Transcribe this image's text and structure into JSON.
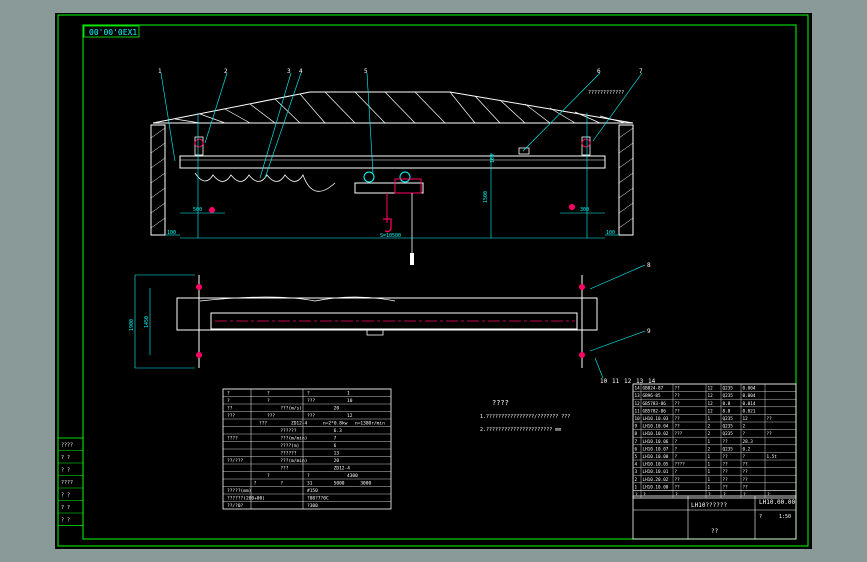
{
  "colors": {
    "background": "#8a9a98",
    "canvas": "#000000",
    "border": "#00ff00",
    "structure": "#ffffff",
    "dimension": "#00ffff",
    "accent": "#ff0066",
    "title_text": "#ffffff"
  },
  "drawing": {
    "sheet_tag": "00'00'0EX1",
    "balloons": [
      "1",
      "2",
      "3",
      "4",
      "5",
      "6",
      "7",
      "8",
      "9",
      "10",
      "11",
      "12",
      "13",
      "14"
    ],
    "top_view_callout": "????????????",
    "dims_side": [
      "500",
      "1500",
      "100",
      "100",
      "300",
      "160"
    ],
    "dims_plan": [
      "1900",
      "1450",
      "1500"
    ],
    "span_label": "S=10500",
    "spec_table_rows": [
      [
        "?",
        "?",
        "?",
        "1"
      ],
      [
        "?",
        "?",
        "???",
        "10"
      ],
      [
        "??",
        "???(m/s)",
        "20"
      ],
      [
        "???",
        "???",
        "???",
        "12"
      ],
      [
        "",
        "???",
        "ZD12-4",
        "n=2*0.8kw",
        "n=1380r/min"
      ],
      [
        "",
        "??????",
        "6.3"
      ],
      [
        "????",
        "???(m/min)",
        "7"
      ],
      [
        "",
        "????(m)",
        "6"
      ],
      [
        "",
        "??????",
        "13"
      ],
      [
        "??/???",
        "???(m/min)",
        "20"
      ],
      [
        "",
        "???",
        "ZD12-4"
      ],
      [
        "",
        "?",
        "?",
        "4300"
      ],
      [
        "",
        "?",
        "?",
        "31",
        "5000",
        "3000"
      ],
      [
        "?????(mm)",
        "#150"
      ],
      [
        "??????(200+00)",
        "?08?7?0C"
      ],
      [
        "??/?0?",
        "?300"
      ]
    ],
    "notes_title": "????",
    "notes_lines": [
      "1.????????????????/??????? ???",
      "2.?????????????????????? mm"
    ],
    "bom_rows": [
      [
        "14",
        "GB824-87",
        "??",
        "12",
        "Q235",
        "0.004"
      ],
      [
        "13",
        "GB96-85",
        "??",
        "12",
        "Q235",
        "0.004"
      ],
      [
        "12",
        "GB5783-86",
        "??",
        "12",
        "8.8",
        "0.014"
      ],
      [
        "11",
        "GB5782-86",
        "??",
        "12",
        "8.8",
        "0.021"
      ],
      [
        "10",
        "LH10.10.03",
        "??",
        "1",
        "Q235",
        "12",
        "??"
      ],
      [
        "9",
        "LH10.10.04",
        "??",
        "2",
        "Q235",
        "2"
      ],
      [
        "8",
        "LH10.10.02",
        "???",
        "2",
        "Q235",
        "?",
        "??"
      ],
      [
        "7",
        "LH10.10.06",
        "?",
        "1",
        "??",
        "28.3"
      ],
      [
        "6",
        "LH10.10.07",
        "?",
        "2",
        "Q235",
        "0.2"
      ],
      [
        "5",
        "LH10.10.08",
        "?",
        "1",
        "??",
        "?",
        "1.5t"
      ],
      [
        "4",
        "LH10.10.05",
        "????",
        "1",
        "??",
        "??"
      ],
      [
        "3",
        "LH10.10.01",
        "?",
        "1",
        "??",
        "??"
      ],
      [
        "2",
        "LH10.20.02",
        "??",
        "1",
        "??",
        "??"
      ],
      [
        "1",
        "LH10.10.00",
        "??",
        "1",
        "??",
        "??"
      ]
    ],
    "bom_header": [
      "?",
      "?",
      "?",
      "?",
      "?",
      "?",
      "?"
    ],
    "title_block": {
      "name": "LH10??????",
      "drawing_no": "LH10.00.00",
      "scale": "1:50",
      "sheet": "?",
      "company": "??"
    },
    "revision_rows": [
      "????",
      "? ?",
      "? ?",
      "????",
      "? ?",
      "? ?",
      "? ?"
    ]
  }
}
